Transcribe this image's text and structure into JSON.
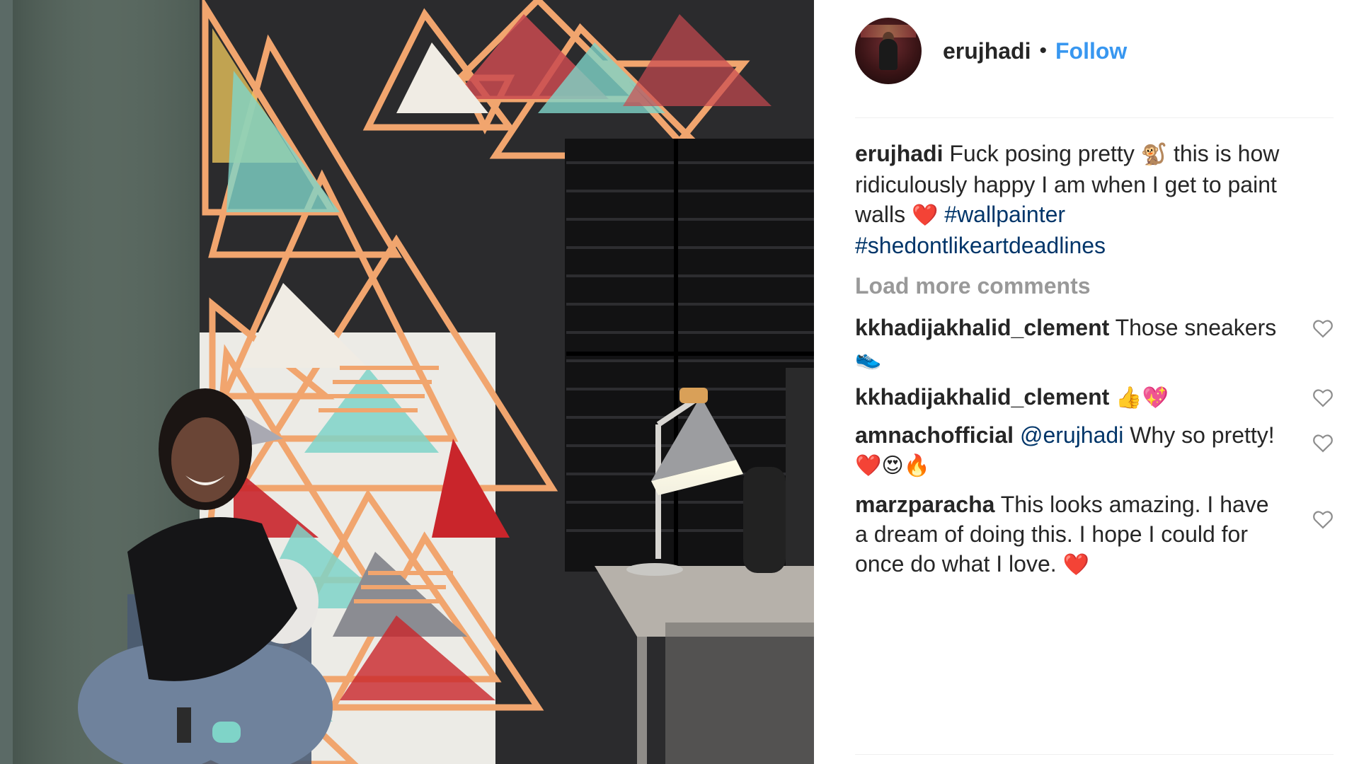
{
  "post": {
    "username": "erujhadi",
    "separator": "•",
    "follow_label": "Follow"
  },
  "caption": {
    "username": "erujhadi",
    "text_part1": "Fuck posing pretty",
    "emoji1": "🐒",
    "text_part2": "this is how ridiculously happy I am when I get to paint walls",
    "emoji2": "❤️",
    "hashtags": [
      "#wallpainter",
      "#shedontlikeartdeadlines"
    ]
  },
  "load_more_label": "Load more comments",
  "comments": [
    {
      "username": "kkhadijakhalid_clement",
      "text": "Those sneakers",
      "emoji": "👟"
    },
    {
      "username": "kkhadijakhalid_clement",
      "text": "",
      "emoji": "👍💖"
    },
    {
      "username": "amnachofficial",
      "mention": "@erujhadi",
      "text": "Why so pretty!",
      "emoji": "❤️😍🔥"
    },
    {
      "username": "marzparacha",
      "text": "This looks amazing. I have a dream of doing this. I hope I could for once do what I love.",
      "emoji": "❤️"
    }
  ],
  "icons": {
    "comment_like": "heart-outline-icon"
  },
  "colors": {
    "link_blue": "#3897f0",
    "hashtag_blue": "#003569",
    "muted_gray": "#999999",
    "text_dark": "#262626"
  }
}
